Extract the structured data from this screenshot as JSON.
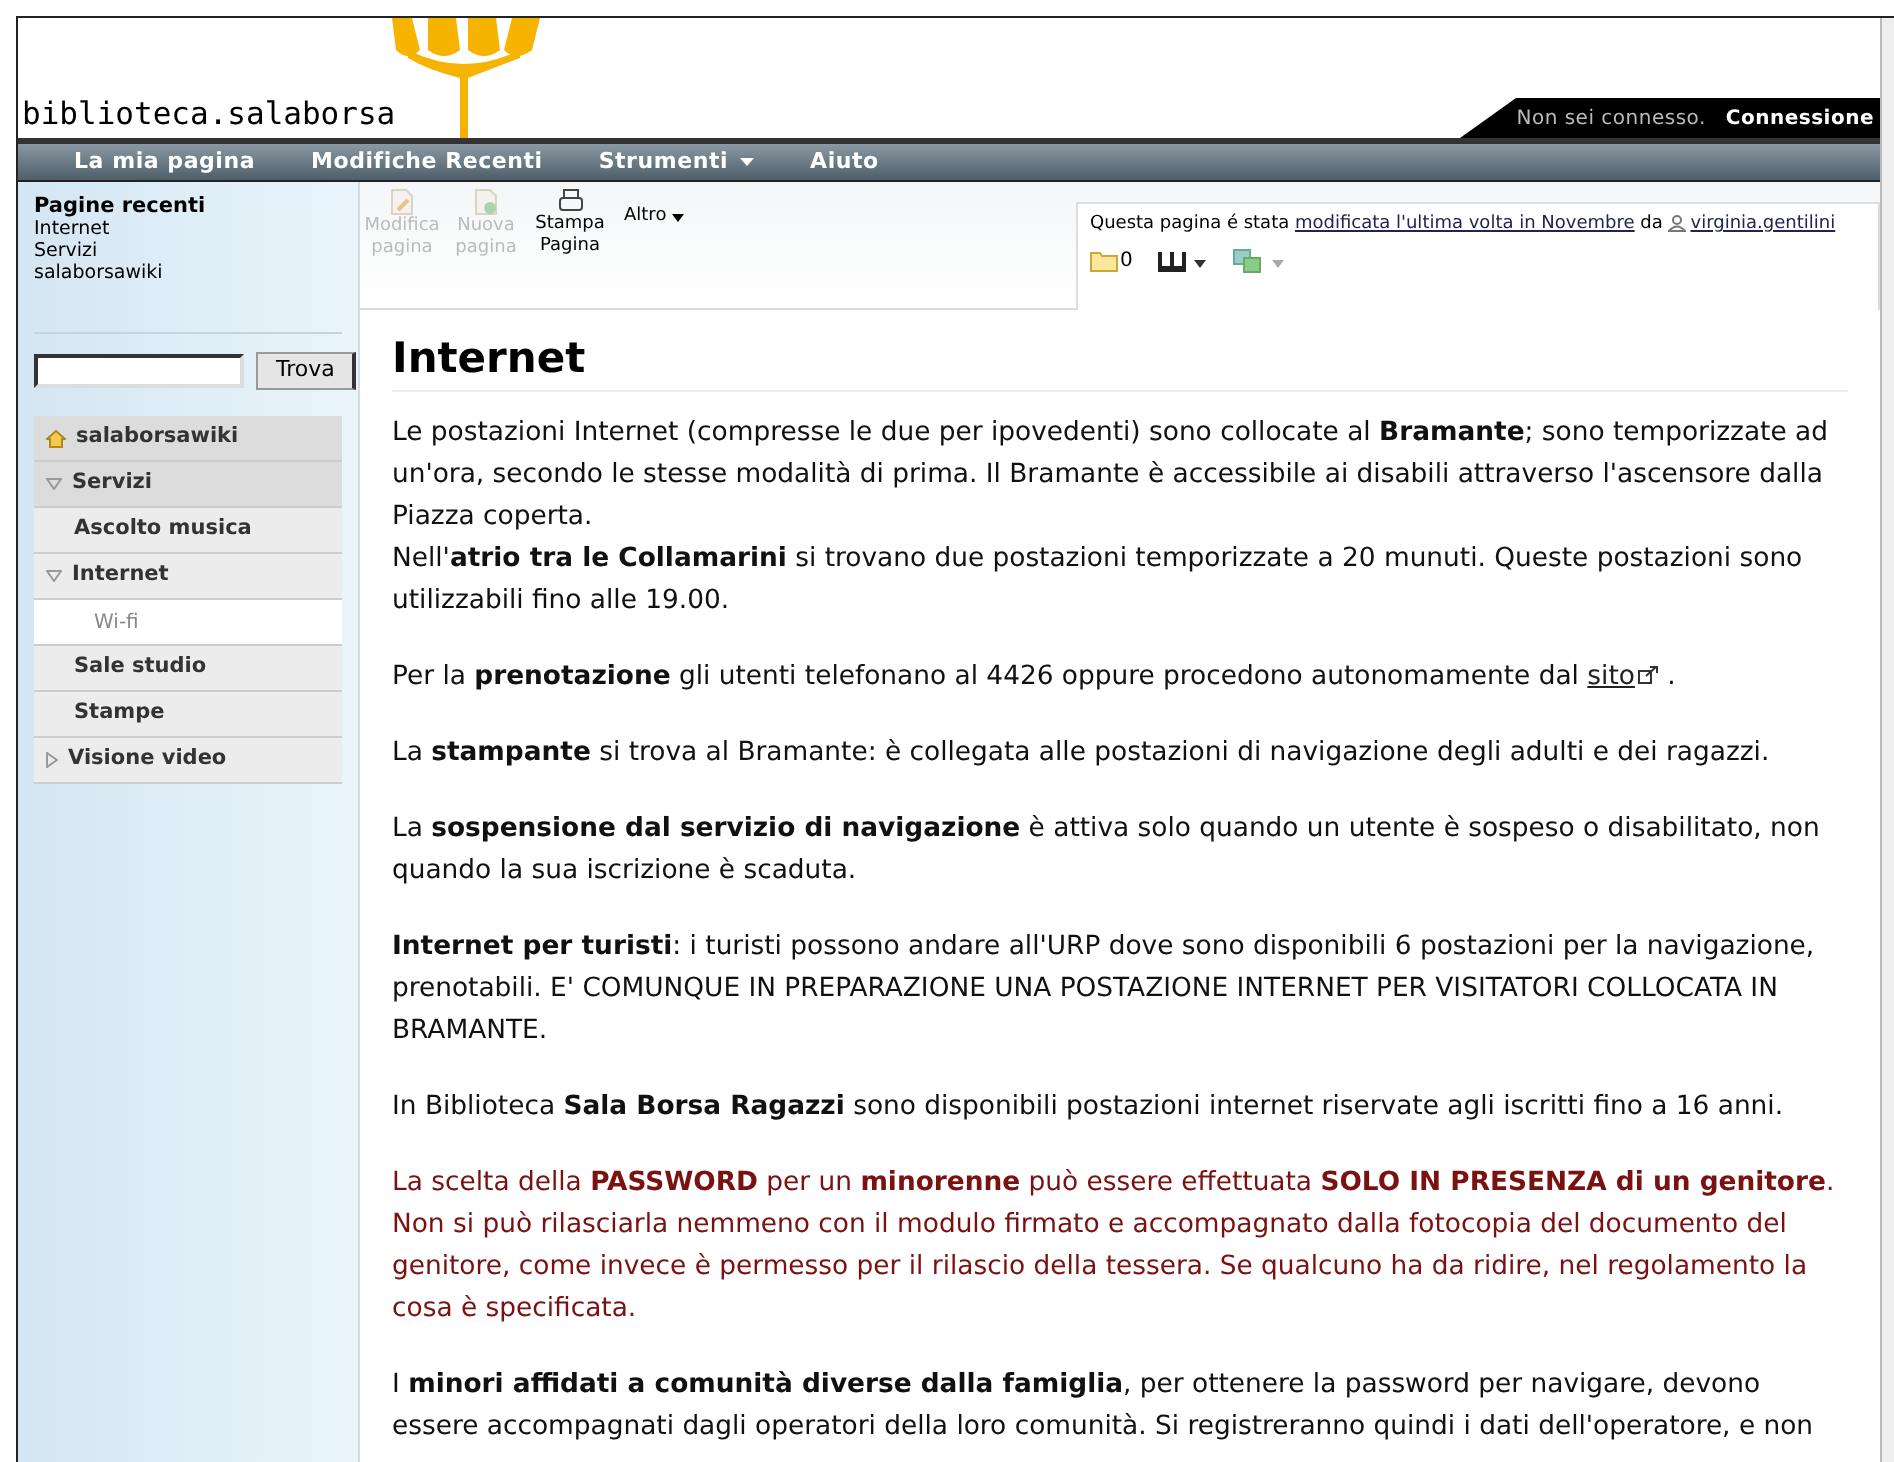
{
  "header": {
    "logo_text": "biblioteca.salaborsa",
    "login_status": "Non sei connesso.",
    "login_link": "Connessione"
  },
  "nav": [
    {
      "label": "La mia pagina",
      "has_menu": false
    },
    {
      "label": "Modifiche Recenti",
      "has_menu": false
    },
    {
      "label": "Strumenti",
      "has_menu": true
    },
    {
      "label": "Aiuto",
      "has_menu": false
    }
  ],
  "sidebar": {
    "recent_title": "Pagine recenti",
    "recent": [
      "Internet",
      "Servizi",
      "salaborsawiki"
    ],
    "search_button": "Trova",
    "menu": [
      {
        "label": "salaborsawiki",
        "kind": "home"
      },
      {
        "label": "Servizi",
        "kind": "folder",
        "expanded": true,
        "children": [
          {
            "label": "Ascolto musica",
            "kind": "page"
          },
          {
            "label": "Internet",
            "kind": "folder",
            "expanded": true,
            "children": [
              {
                "label": "Wi-fi",
                "kind": "page"
              }
            ]
          },
          {
            "label": "Sale studio",
            "kind": "page"
          },
          {
            "label": "Stampe",
            "kind": "page"
          },
          {
            "label": "Visione video",
            "kind": "folder",
            "expanded": false
          }
        ]
      }
    ]
  },
  "toolbar": [
    {
      "label": "Modifica\npagina",
      "kind": "edit",
      "disabled": true
    },
    {
      "label": "Nuova\npagina",
      "kind": "new",
      "disabled": true
    },
    {
      "label": "Stampa\nPagina",
      "kind": "print",
      "disabled": false
    },
    {
      "label": "Altro",
      "kind": "menu",
      "disabled": false
    }
  ],
  "page_info": {
    "prefix": "Questa pagina é stata",
    "modified_link": "modificata l'ultima volta in Novembre",
    "by": "da",
    "user": "virginia.gentilini",
    "attachments": "0"
  },
  "title": "Internet",
  "paragraphs": [
    {
      "kind": "normal",
      "text": "Le postazioni Internet (compresse le due per ipovedenti) sono collocate al **Bramante**; sono temporizzate ad un'ora, secondo le stesse modalità di prima. Il Bramante è accessibile ai disabili attraverso l'ascensore dalla Piazza coperta.\nNell'**atrio tra le Collamarini** si trovano due postazioni temporizzate a 20 munuti. Queste postazioni sono utilizzabili fino alle 19.00."
    },
    {
      "kind": "normal",
      "text": "Per la **prenotazione** gli utenti telefonano al 4426 oppure procedono autonomamente dal",
      "link": "sito",
      "tail": "."
    },
    {
      "kind": "normal",
      "text": "La **stampante** si trova al Bramante: è collegata alle postazioni di navigazione degli adulti e dei ragazzi."
    },
    {
      "kind": "normal",
      "text": "La **sospensione dal servizio di navigazione** è attiva solo quando un utente è sospeso o disabilitato, non quando la sua iscrizione è scaduta."
    },
    {
      "kind": "normal",
      "text": "**Internet per turisti**: i turisti possono andare all'URP dove sono disponibili 6 postazioni per la navigazione, prenotabili. E' COMUNQUE IN PREPARAZIONE UNA POSTAZIONE INTERNET PER VISITATORI COLLOCATA IN BRAMANTE."
    },
    {
      "kind": "normal",
      "text": "In Biblioteca **Sala Borsa Ragazzi** sono disponibili postazioni internet riservate agli iscritti fino a 16 anni."
    },
    {
      "kind": "notice",
      "text": "La scelta della **PASSWORD** per un **minorenne** può essere effettuata **SOLO IN PRESENZA di un genitore**. Non si può rilasciarla nemmeno con il modulo firmato e accompagnato dalla fotocopia del documento del genitore, come invece è permesso per il rilascio della tessera. Se qualcuno ha da ridire, nel regolamento la cosa è specificata."
    },
    {
      "kind": "normal",
      "text": "I **minori affidati a comunità diverse dalla famiglia**, per ottenere la password per navigare, devono essere accompagnati dagli operatori della loro comunità. Si registreranno quindi i dati dell'operatore, e non"
    }
  ]
}
